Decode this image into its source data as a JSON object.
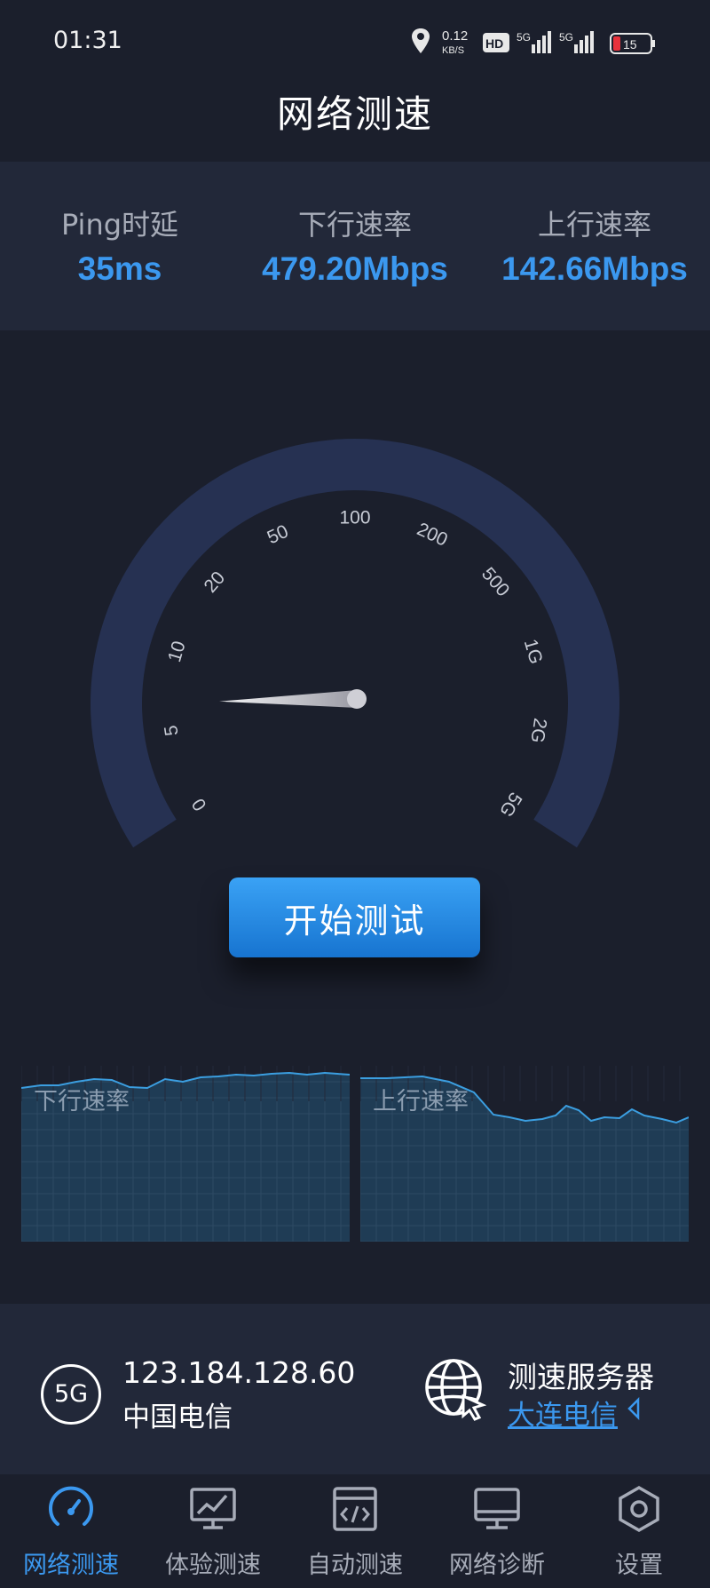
{
  "status_bar": {
    "time": "01:31",
    "net_speed_value": "0.12",
    "net_speed_unit": "KB/S",
    "hd_label": "HD",
    "signal_label_1": "5G",
    "signal_label_2": "5G",
    "battery": "15",
    "icons": [
      "location-icon",
      "hd-icon",
      "signal-5g-icon",
      "signal-5g-icon",
      "battery-icon"
    ]
  },
  "header": {
    "title": "网络测速"
  },
  "metrics": {
    "ping": {
      "label": "Ping时延",
      "value": "35ms"
    },
    "download": {
      "label": "下行速率",
      "value": "479.20Mbps"
    },
    "upload": {
      "label": "上行速率",
      "value": "142.66Mbps"
    }
  },
  "gauge": {
    "ticks": [
      "0",
      "5",
      "10",
      "20",
      "50",
      "100",
      "200",
      "500",
      "1G",
      "2G",
      "5G"
    ],
    "needle_tick_fraction": 0.13,
    "colors": {
      "arc": "#263152",
      "needle": "#cfcfd6"
    }
  },
  "actions": {
    "start_label": "开始测试"
  },
  "charts": {
    "download": {
      "label": "下行速率"
    },
    "upload": {
      "label": "上行速率"
    },
    "colors": {
      "fill": "#1f3c55",
      "line": "#3b9ee0",
      "grid": "#2e4a63"
    }
  },
  "network": {
    "type_badge": "5G",
    "ip": "123.184.128.60",
    "carrier": "中国电信",
    "server_title": "测速服务器",
    "server_name": "大连电信"
  },
  "nav": {
    "items": [
      {
        "label": "网络测速",
        "icon": "speedometer-icon",
        "active": true
      },
      {
        "label": "体验测速",
        "icon": "monitor-chart-icon",
        "active": false
      },
      {
        "label": "自动测速",
        "icon": "code-window-icon",
        "active": false
      },
      {
        "label": "网络诊断",
        "icon": "desktop-icon",
        "active": false
      },
      {
        "label": "设置",
        "icon": "settings-hexagon-icon",
        "active": false
      }
    ]
  },
  "colors": {
    "background": "#1b1f2c",
    "panel": "#222839",
    "accent": "#3b98ef",
    "button_top": "#3aa2f5",
    "button_bottom": "#1774d0"
  }
}
